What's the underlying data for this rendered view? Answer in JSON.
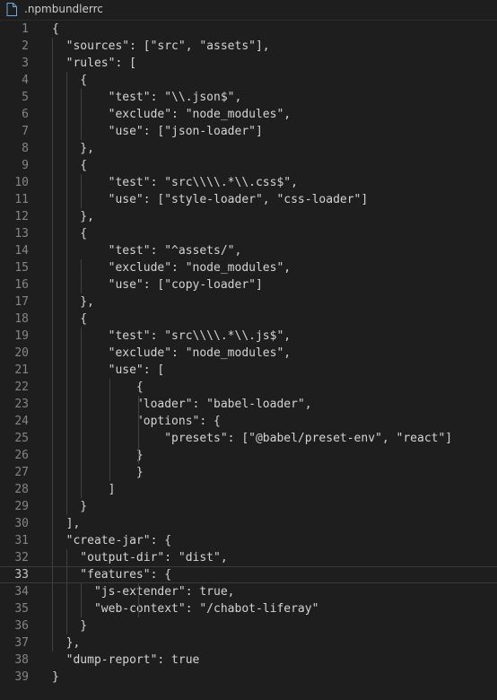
{
  "tab": {
    "icon": "file-icon",
    "filename": ".npmbundlerrc"
  },
  "editor": {
    "current_line": 33,
    "lines": [
      {
        "n": "1",
        "text": "{"
      },
      {
        "n": "2",
        "text": "  \"sources\": [\"src\", \"assets\"],"
      },
      {
        "n": "3",
        "text": "  \"rules\": ["
      },
      {
        "n": "4",
        "text": "    {"
      },
      {
        "n": "5",
        "text": "        \"test\": \"\\\\.json$\","
      },
      {
        "n": "6",
        "text": "        \"exclude\": \"node_modules\","
      },
      {
        "n": "7",
        "text": "        \"use\": [\"json-loader\"]"
      },
      {
        "n": "8",
        "text": "    },"
      },
      {
        "n": "9",
        "text": "    {"
      },
      {
        "n": "10",
        "text": "        \"test\": \"src\\\\\\\\.*\\\\.css$\","
      },
      {
        "n": "11",
        "text": "        \"use\": [\"style-loader\", \"css-loader\"]"
      },
      {
        "n": "12",
        "text": "    },"
      },
      {
        "n": "13",
        "text": "    {"
      },
      {
        "n": "14",
        "text": "        \"test\": \"^assets/\","
      },
      {
        "n": "15",
        "text": "        \"exclude\": \"node_modules\","
      },
      {
        "n": "16",
        "text": "        \"use\": [\"copy-loader\"]"
      },
      {
        "n": "17",
        "text": "    },"
      },
      {
        "n": "18",
        "text": "    {"
      },
      {
        "n": "19",
        "text": "        \"test\": \"src\\\\\\\\.*\\\\.js$\","
      },
      {
        "n": "20",
        "text": "        \"exclude\": \"node_modules\","
      },
      {
        "n": "21",
        "text": "        \"use\": ["
      },
      {
        "n": "22",
        "text": "            {"
      },
      {
        "n": "23",
        "text": "            \"loader\": \"babel-loader\","
      },
      {
        "n": "24",
        "text": "            \"options\": {"
      },
      {
        "n": "25",
        "text": "                \"presets\": [\"@babel/preset-env\", \"react\"]"
      },
      {
        "n": "26",
        "text": "            }"
      },
      {
        "n": "27",
        "text": "            }"
      },
      {
        "n": "28",
        "text": "        ]"
      },
      {
        "n": "29",
        "text": "    }"
      },
      {
        "n": "30",
        "text": "  ],"
      },
      {
        "n": "31",
        "text": "  \"create-jar\": {"
      },
      {
        "n": "32",
        "text": "    \"output-dir\": \"dist\","
      },
      {
        "n": "33",
        "text": "    \"features\": {"
      },
      {
        "n": "34",
        "text": "      \"js-extender\": true,"
      },
      {
        "n": "35",
        "text": "      \"web-context\": \"/chabot-liferay\""
      },
      {
        "n": "36",
        "text": "    }"
      },
      {
        "n": "37",
        "text": "  },"
      },
      {
        "n": "38",
        "text": "  \"dump-report\": true"
      },
      {
        "n": "39",
        "text": "}"
      }
    ]
  }
}
